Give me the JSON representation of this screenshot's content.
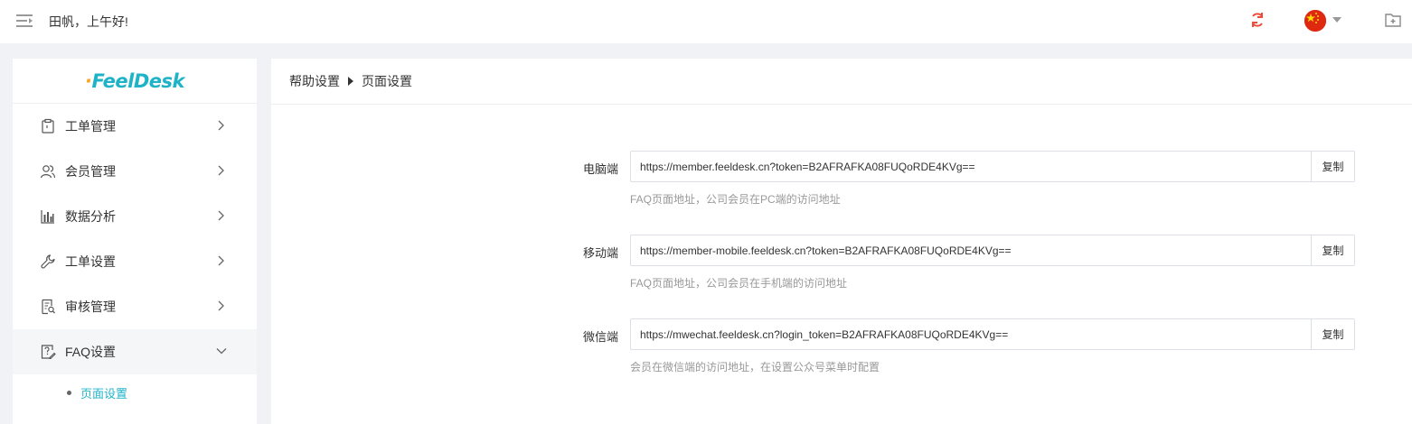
{
  "header": {
    "greeting": "田帆，上午好!",
    "icons": [
      "menu-toggle-icon",
      "sync-icon",
      "china-flag-icon",
      "add-folder-icon"
    ]
  },
  "sidebar": {
    "logo_text_prefix": "·",
    "logo_text": "FeelDesk",
    "items": [
      {
        "label": "工单管理",
        "icon": "clipboard-icon"
      },
      {
        "label": "会员管理",
        "icon": "users-icon"
      },
      {
        "label": "数据分析",
        "icon": "bar-chart-icon"
      },
      {
        "label": "工单设置",
        "icon": "wrench-icon"
      },
      {
        "label": "审核管理",
        "icon": "document-search-icon"
      },
      {
        "label": "FAQ设置",
        "icon": "faq-edit-icon",
        "expanded": true
      }
    ],
    "sub_items": [
      {
        "label": "页面设置",
        "active": true
      }
    ]
  },
  "breadcrumb": {
    "parent": "帮助设置",
    "current": "页面设置"
  },
  "rows": [
    {
      "label": "电脑端",
      "url": "https://member.feeldesk.cn?token=B2AFRAFKA08FUQoRDE4KVg==",
      "button": "复制",
      "hint": "FAQ页面地址，公司会员在PC端的访问地址"
    },
    {
      "label": "移动端",
      "url": "https://member-mobile.feeldesk.cn?token=B2AFRAFKA08FUQoRDE4KVg==",
      "button": "复制",
      "hint": "FAQ页面地址，公司会员在手机端的访问地址"
    },
    {
      "label": "微信端",
      "url": "https://mwechat.feeldesk.cn?login_token=B2AFRAFKA08FUQoRDE4KVg==",
      "button": "复制",
      "hint": "会员在微信端的访问地址，在设置公众号菜单时配置"
    }
  ],
  "colors": {
    "accent": "#1fb3c8",
    "logo_dot": "#f5a623",
    "sync_icon": "#f04a3a",
    "flag_red": "#de2910",
    "flag_star": "#ffde00"
  }
}
